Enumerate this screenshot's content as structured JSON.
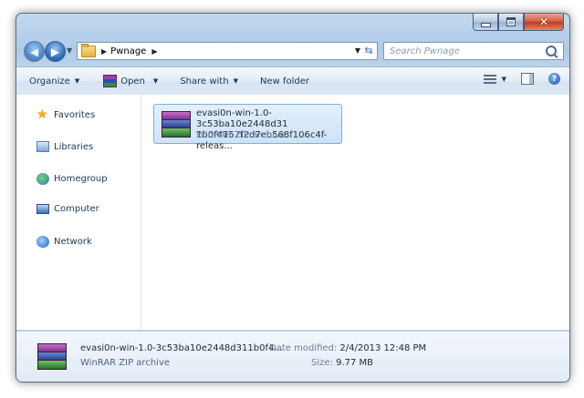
{
  "window": {
    "caption": {
      "min": "–",
      "max": "□",
      "close": "✕"
    }
  },
  "address": {
    "breadcrumb": [
      "Pwnage"
    ],
    "search_placeholder": "Search Pwnage"
  },
  "commands": {
    "organize": "Organize",
    "open": "Open",
    "share_with": "Share with",
    "new_folder": "New folder"
  },
  "nav": {
    "items": [
      {
        "label": "Favorites",
        "icon": "star-icon"
      },
      {
        "label": "Libraries",
        "icon": "libraries-icon"
      },
      {
        "label": "Homegroup",
        "icon": "homegroup-icon"
      },
      {
        "label": "Computer",
        "icon": "computer-icon"
      },
      {
        "label": "Network",
        "icon": "network-icon"
      }
    ]
  },
  "files": [
    {
      "name_line1": "evasi0n-win-1.0-3c53ba10e2448d31",
      "name_line2": "1b0f4157f2d7eb568f106c4f-releas...",
      "type": "WinRAR ZIP archive",
      "icon": "winrar-archive-icon"
    }
  ],
  "details": {
    "name": "evasi0n-win-1.0-3c53ba10e2448d311b0f4...",
    "type": "WinRAR ZIP archive",
    "modified_label": "Date modified:",
    "modified_value": "2/4/2013 12:48 PM",
    "size_label": "Size:",
    "size_value": "9.77 MB"
  },
  "colors": {
    "selection_fill": "#cde2f8",
    "selection_border": "#84acdd",
    "frame": "#aecbe8",
    "rar_purple": "#9b3fa5",
    "rar_blue": "#2f4fa8",
    "rar_green": "#3a8d3a"
  }
}
